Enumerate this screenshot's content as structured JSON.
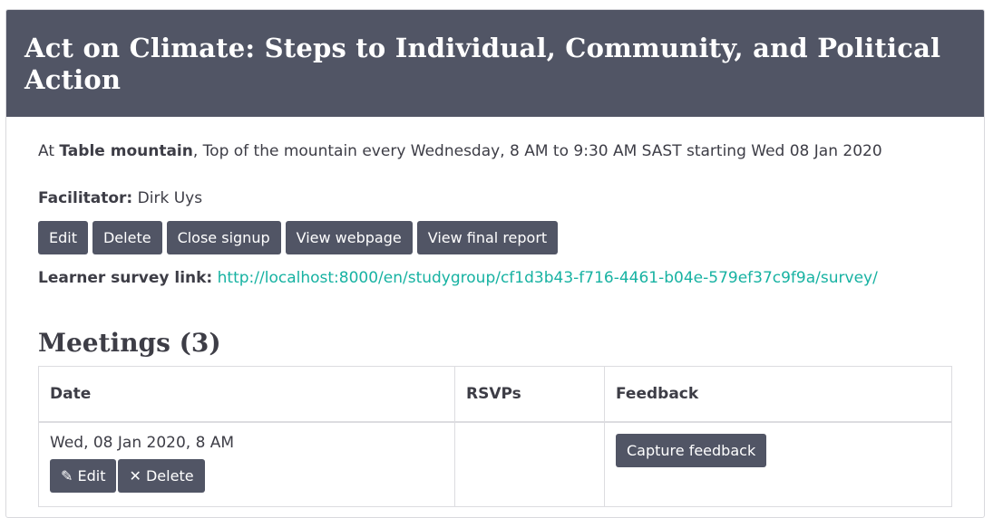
{
  "header": {
    "title": "Act on Climate: Steps to Individual, Community, and Political Action"
  },
  "details": {
    "at_prefix": "At ",
    "venue": "Table mountain",
    "schedule": ", Top of the mountain every Wednesday, 8 AM to 9:30 AM SAST starting Wed 08 Jan 2020",
    "facilitator_label": "Facilitator:",
    "facilitator_name": " Dirk Uys"
  },
  "actions": {
    "edit": "Edit",
    "delete": "Delete",
    "close_signup": "Close signup",
    "view_webpage": "View webpage",
    "view_final_report": "View final report"
  },
  "survey": {
    "label": "Learner survey link:",
    "url": "http://localhost:8000/en/studygroup/cf1d3b43-f716-4461-b04e-579ef37c9f9a/survey/"
  },
  "meetings": {
    "heading": "Meetings (3)",
    "columns": [
      "Date",
      "RSVPs",
      "Feedback"
    ],
    "rows": [
      {
        "date": "Wed, 08 Jan 2020, 8 AM",
        "rsvps": "",
        "edit_label": "Edit",
        "delete_label": "Delete",
        "feedback_button": "Capture feedback"
      }
    ]
  }
}
